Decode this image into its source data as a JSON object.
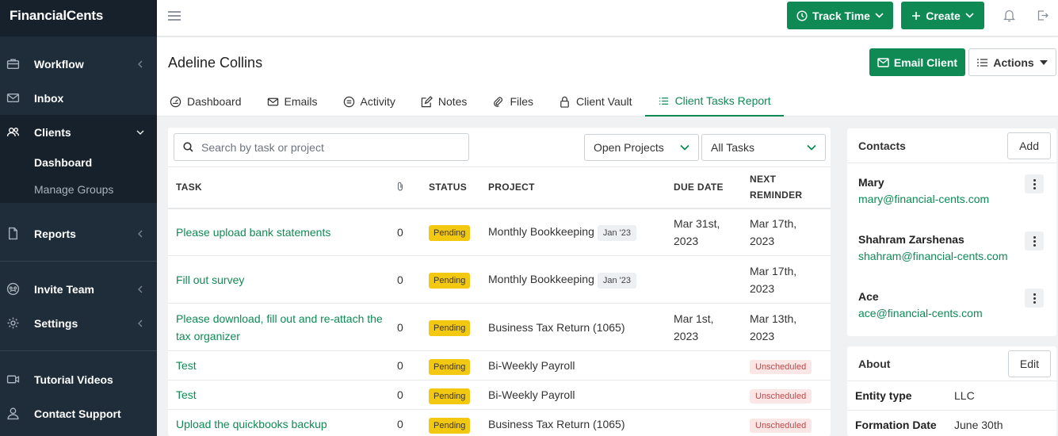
{
  "brand": "FinancialCents",
  "sidebar": {
    "items": [
      {
        "label": "Workflow",
        "icon": "briefcase-icon"
      },
      {
        "label": "Inbox",
        "icon": "envelope-icon"
      },
      {
        "label": "Clients",
        "icon": "users-icon"
      },
      {
        "label": "Reports",
        "icon": "file-icon"
      },
      {
        "label": "Invite Team",
        "icon": "team-icon"
      },
      {
        "label": "Settings",
        "icon": "gear-icon"
      },
      {
        "label": "Tutorial Videos",
        "icon": "video-icon"
      },
      {
        "label": "Contact Support",
        "icon": "user-icon"
      }
    ],
    "clients_sub": [
      {
        "label": "Dashboard"
      },
      {
        "label": "Manage Groups"
      }
    ]
  },
  "topbar": {
    "track_time": "Track Time",
    "create": "Create"
  },
  "header": {
    "client_name": "Adeline Collins",
    "email_client": "Email Client",
    "actions": "Actions",
    "tabs": [
      {
        "label": "Dashboard"
      },
      {
        "label": "Emails"
      },
      {
        "label": "Activity"
      },
      {
        "label": "Notes"
      },
      {
        "label": "Files"
      },
      {
        "label": "Client Vault"
      },
      {
        "label": "Client Tasks Report"
      }
    ]
  },
  "tasks": {
    "search_placeholder": "Search by task or project",
    "filter_projects": "Open Projects",
    "filter_tasks": "All Tasks",
    "columns": {
      "task": "TASK",
      "status": "STATUS",
      "project": "PROJECT",
      "due": "DUE DATE",
      "reminder": "NEXT REMINDER"
    },
    "rows": [
      {
        "task": "Please upload bank statements",
        "count": "0",
        "status": "Pending",
        "project": "Monthly Bookkeeping",
        "tag": "Jan '23",
        "due": "Mar 31st, 2023",
        "reminder": "Mar 17th, 2023"
      },
      {
        "task": "Fill out survey",
        "count": "0",
        "status": "Pending",
        "project": "Monthly Bookkeeping",
        "tag": "Jan '23",
        "due": "",
        "reminder": "Mar 17th, 2023"
      },
      {
        "task": "Please download, fill out and re-attach the tax organizer",
        "count": "0",
        "status": "Pending",
        "project": "Business Tax Return (1065)",
        "tag": "",
        "due": "Mar 1st, 2023",
        "reminder": "Mar 13th, 2023"
      },
      {
        "task": "Test",
        "count": "0",
        "status": "Pending",
        "project": "Bi-Weekly Payroll",
        "tag": "",
        "due": "",
        "reminder": "",
        "unscheduled": "Unscheduled"
      },
      {
        "task": "Test",
        "count": "0",
        "status": "Pending",
        "project": "Bi-Weekly Payroll",
        "tag": "",
        "due": "",
        "reminder": "",
        "unscheduled": "Unscheduled"
      },
      {
        "task": "Upload the quickbooks backup",
        "count": "0",
        "status": "Pending",
        "project": "Business Tax Return (1065)",
        "tag": "",
        "due": "",
        "reminder": "",
        "unscheduled": "Unscheduled"
      }
    ]
  },
  "contacts": {
    "title": "Contacts",
    "add": "Add",
    "list": [
      {
        "name": "Mary",
        "email": "mary@financial-cents.com"
      },
      {
        "name": "Shahram Zarshenas",
        "email": "shahram@financial-cents.com"
      },
      {
        "name": "Ace",
        "email": "ace@financial-cents.com"
      }
    ]
  },
  "about": {
    "title": "About",
    "edit": "Edit",
    "rows": [
      {
        "key": "Entity type",
        "value": "LLC"
      },
      {
        "key": "Formation Date",
        "value": "June 30th"
      }
    ]
  },
  "colors": {
    "accent": "#0f8a55",
    "sidebar": "#1f2d3a",
    "pending": "#f2c811",
    "unscheduled": "#c64545"
  }
}
